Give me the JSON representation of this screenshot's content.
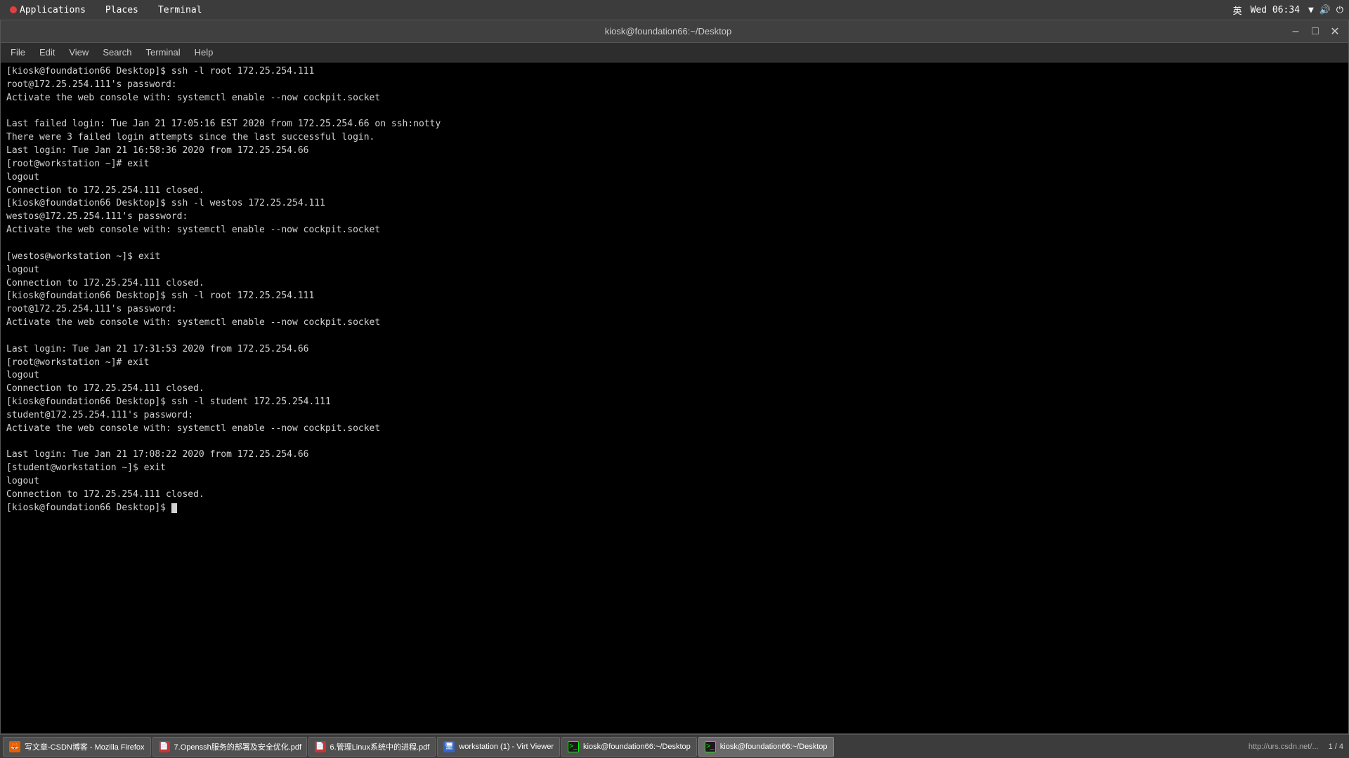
{
  "system_bar": {
    "apps_label": "Applications",
    "places_label": "Places",
    "terminal_label": "Terminal",
    "time": "Wed 06:34",
    "lang": "英"
  },
  "terminal_window": {
    "title": "kiosk@foundation66:~/Desktop",
    "menu_items": [
      "File",
      "Edit",
      "View",
      "Search",
      "Terminal",
      "Help"
    ],
    "content_lines": [
      "[kiosk@foundation66 Desktop]$ ssh -l root 172.25.254.111",
      "root@172.25.254.111's password: ",
      "Activate the web console with: systemctl enable --now cockpit.socket",
      "",
      "Last failed login: Tue Jan 21 17:05:16 EST 2020 from 172.25.254.66 on ssh:notty",
      "There were 3 failed login attempts since the last successful login.",
      "Last login: Tue Jan 21 16:58:36 2020 from 172.25.254.66",
      "[root@workstation ~]# exit",
      "logout",
      "Connection to 172.25.254.111 closed.",
      "[kiosk@foundation66 Desktop]$ ssh -l westos 172.25.254.111",
      "westos@172.25.254.111's password: ",
      "Activate the web console with: systemctl enable --now cockpit.socket",
      "",
      "[westos@workstation ~]$ exit",
      "logout",
      "Connection to 172.25.254.111 closed.",
      "[kiosk@foundation66 Desktop]$ ssh -l root 172.25.254.111",
      "root@172.25.254.111's password: ",
      "Activate the web console with: systemctl enable --now cockpit.socket",
      "",
      "Last login: Tue Jan 21 17:31:53 2020 from 172.25.254.66",
      "[root@workstation ~]# exit",
      "logout",
      "Connection to 172.25.254.111 closed.",
      "[kiosk@foundation66 Desktop]$ ssh -l student 172.25.254.111",
      "student@172.25.254.111's password: ",
      "Activate the web console with: systemctl enable --now cockpit.socket",
      "",
      "Last login: Tue Jan 21 17:08:22 2020 from 172.25.254.66",
      "[student@workstation ~]$ exit",
      "logout",
      "Connection to 172.25.254.111 closed.",
      "[kiosk@foundation66 Desktop]$ "
    ]
  },
  "taskbar": {
    "items": [
      {
        "label": "写文章-CSDN博客 - Mozilla Firefox",
        "icon_type": "firefox",
        "icon_char": "🦊"
      },
      {
        "label": "7.Openssh服务的部署及安全优化.pdf",
        "icon_type": "pdf",
        "icon_char": "📄"
      },
      {
        "label": "6.管理Linux系统中的进程.pdf",
        "icon_type": "pdf",
        "icon_char": "📄"
      },
      {
        "label": "workstation (1) - Virt Viewer",
        "icon_type": "virt",
        "icon_char": "🖥"
      },
      {
        "label": "kiosk@foundation66:~/Desktop",
        "icon_type": "term",
        "icon_char": ">_",
        "active": false
      },
      {
        "label": "kiosk@foundation66:~/Desktop",
        "icon_type": "term",
        "icon_char": ">_",
        "active": true
      }
    ],
    "url": "http://urs.csdn.net/...",
    "page": "1 / 4"
  }
}
